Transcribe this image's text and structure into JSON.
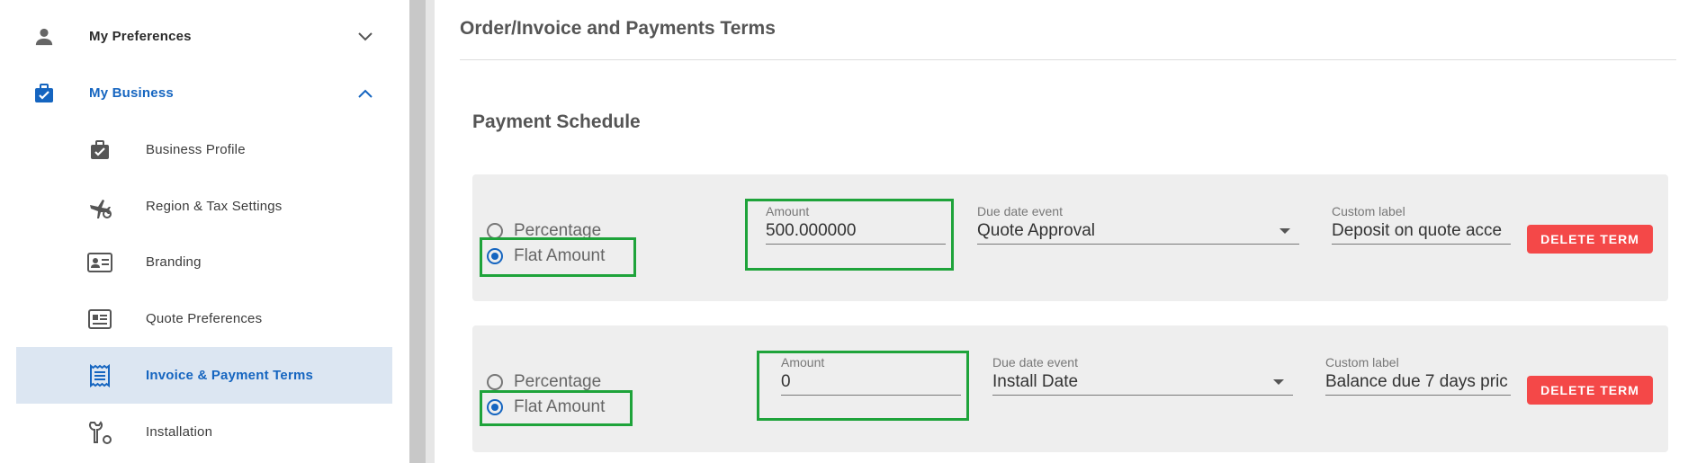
{
  "sidebar": {
    "items": [
      {
        "label": "My Preferences",
        "icon": "person-icon"
      },
      {
        "label": "My Business",
        "icon": "briefcase-check-icon"
      },
      {
        "label": "Business Profile",
        "icon": "briefcase-check-icon"
      },
      {
        "label": "Region & Tax Settings",
        "icon": "plane-gear-icon"
      },
      {
        "label": "Branding",
        "icon": "id-card-icon"
      },
      {
        "label": "Quote Preferences",
        "icon": "quote-doc-icon"
      },
      {
        "label": "Invoice & Payment Terms",
        "icon": "receipt-icon"
      },
      {
        "label": "Installation",
        "icon": "tools-gear-icon"
      }
    ]
  },
  "main": {
    "title": "Order/Invoice and Payments Terms",
    "section_title": "Payment Schedule",
    "terms": [
      {
        "option_percentage": "Percentage",
        "option_flat": "Flat Amount",
        "amount_label": "Amount",
        "amount_value": "500.000000",
        "due_label": "Due date event",
        "due_value": "Quote Approval",
        "custom_label": "Custom label",
        "custom_value": "Deposit on quote acce",
        "delete_label": "DELETE TERM"
      },
      {
        "option_percentage": "Percentage",
        "option_flat": "Flat Amount",
        "amount_label": "Amount",
        "amount_value": "0",
        "due_label": "Due date event",
        "due_value": "Install Date",
        "custom_label": "Custom label",
        "custom_value": "Balance due 7 days pric",
        "delete_label": "DELETE TERM"
      }
    ]
  },
  "colors": {
    "accent": "#1565c0",
    "highlight": "#1ea33a",
    "danger": "#f44848"
  }
}
